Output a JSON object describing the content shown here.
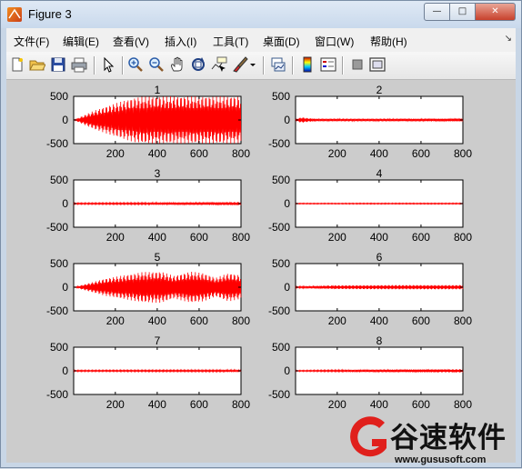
{
  "window": {
    "title": "Figure 3",
    "buttons": {
      "minimize": "—",
      "maximize": "□",
      "close": "✕"
    }
  },
  "menubar": {
    "items": [
      "文件(F)",
      "编辑(E)",
      "查看(V)",
      "插入(I)",
      "工具(T)",
      "桌面(D)",
      "窗口(W)",
      "帮助(H)"
    ],
    "overflow_icon": "dock-arrow-icon"
  },
  "toolbar": {
    "buttons": [
      {
        "name": "new-figure",
        "icon": "new-file-icon"
      },
      {
        "name": "open-file",
        "icon": "folder-open-icon"
      },
      {
        "name": "save-figure",
        "icon": "floppy-disk-icon"
      },
      {
        "name": "print-figure",
        "icon": "printer-icon"
      },
      {
        "name": "edit-plot",
        "icon": "cursor-arrow-icon"
      },
      {
        "name": "zoom-in",
        "icon": "zoom-in-icon"
      },
      {
        "name": "zoom-out",
        "icon": "zoom-out-icon"
      },
      {
        "name": "pan",
        "icon": "hand-icon"
      },
      {
        "name": "rotate-3d",
        "icon": "rotate-3d-icon"
      },
      {
        "name": "data-cursor",
        "icon": "data-cursor-icon"
      },
      {
        "name": "brush",
        "icon": "brush-icon"
      },
      {
        "name": "link-plot",
        "icon": "link-plot-icon"
      },
      {
        "name": "insert-colorbar",
        "icon": "colorbar-icon"
      },
      {
        "name": "insert-legend",
        "icon": "legend-icon"
      },
      {
        "name": "hide-plot-tools",
        "icon": "hide-tools-icon"
      },
      {
        "name": "show-plot-tools",
        "icon": "show-tools-icon"
      }
    ]
  },
  "watermark": {
    "brand": "谷速软件",
    "url": "www.gususoft.com",
    "logo_color": "#e0201c"
  },
  "chart_data": [
    {
      "type": "line",
      "title": "1",
      "xlim": [
        1,
        800
      ],
      "ylim": [
        -500,
        500
      ],
      "xticks": [
        200,
        400,
        600,
        800
      ],
      "yticks": [
        500,
        0,
        -500
      ],
      "series": [
        {
          "color": "#ff0000",
          "envelope": [
            [
              1,
              0
            ],
            [
              100,
              200
            ],
            [
              200,
              350
            ],
            [
              250,
              420
            ],
            [
              300,
              480
            ],
            [
              350,
              500
            ],
            [
              800,
              500
            ]
          ]
        }
      ]
    },
    {
      "type": "line",
      "title": "2",
      "xlim": [
        1,
        800
      ],
      "ylim": [
        -500,
        500
      ],
      "xticks": [
        200,
        400,
        600,
        800
      ],
      "yticks": [
        500,
        0,
        -500
      ],
      "series": [
        {
          "color": "#ff0000",
          "envelope": [
            [
              1,
              20
            ],
            [
              30,
              60
            ],
            [
              60,
              40
            ],
            [
              100,
              25
            ],
            [
              400,
              25
            ],
            [
              800,
              30
            ]
          ]
        }
      ]
    },
    {
      "type": "line",
      "title": "3",
      "xlim": [
        1,
        800
      ],
      "ylim": [
        -500,
        500
      ],
      "xticks": [
        200,
        400,
        600,
        800
      ],
      "yticks": [
        500,
        0,
        -500
      ],
      "series": [
        {
          "color": "#ff0000",
          "envelope": [
            [
              1,
              15
            ],
            [
              400,
              20
            ],
            [
              700,
              30
            ],
            [
              800,
              35
            ]
          ]
        }
      ]
    },
    {
      "type": "line",
      "title": "4",
      "xlim": [
        1,
        800
      ],
      "ylim": [
        -500,
        500
      ],
      "xticks": [
        200,
        400,
        600,
        800
      ],
      "yticks": [
        500,
        0,
        -500
      ],
      "series": [
        {
          "color": "#ff0000",
          "envelope": [
            [
              1,
              10
            ],
            [
              800,
              12
            ]
          ]
        }
      ]
    },
    {
      "type": "line",
      "title": "5",
      "xlim": [
        1,
        800
      ],
      "ylim": [
        -500,
        500
      ],
      "xticks": [
        200,
        400,
        600,
        800
      ],
      "yticks": [
        500,
        0,
        -500
      ],
      "series": [
        {
          "color": "#ff0000",
          "envelope": [
            [
              1,
              0
            ],
            [
              150,
              180
            ],
            [
              250,
              260
            ],
            [
              330,
              320
            ],
            [
              420,
              330
            ],
            [
              480,
              240
            ],
            [
              560,
              330
            ],
            [
              620,
              300
            ],
            [
              680,
              200
            ],
            [
              740,
              300
            ],
            [
              800,
              250
            ]
          ]
        }
      ]
    },
    {
      "type": "line",
      "title": "6",
      "xlim": [
        1,
        800
      ],
      "ylim": [
        -500,
        500
      ],
      "xticks": [
        200,
        400,
        600,
        800
      ],
      "yticks": [
        500,
        0,
        -500
      ],
      "series": [
        {
          "color": "#ff0000",
          "envelope": [
            [
              1,
              15
            ],
            [
              200,
              40
            ],
            [
              500,
              45
            ],
            [
              800,
              45
            ]
          ]
        }
      ]
    },
    {
      "type": "line",
      "title": "7",
      "xlim": [
        1,
        800
      ],
      "ylim": [
        -500,
        500
      ],
      "xticks": [
        200,
        400,
        600,
        800
      ],
      "yticks": [
        500,
        0,
        -500
      ],
      "series": [
        {
          "color": "#ff0000",
          "envelope": [
            [
              1,
              15
            ],
            [
              800,
              20
            ]
          ]
        }
      ]
    },
    {
      "type": "line",
      "title": "8",
      "xlim": [
        1,
        800
      ],
      "ylim": [
        -500,
        500
      ],
      "xticks": [
        200,
        400,
        600,
        800
      ],
      "yticks": [
        500,
        0,
        -500
      ],
      "series": [
        {
          "color": "#ff0000",
          "envelope": [
            [
              1,
              12
            ],
            [
              400,
              25
            ],
            [
              800,
              35
            ]
          ]
        }
      ]
    }
  ]
}
